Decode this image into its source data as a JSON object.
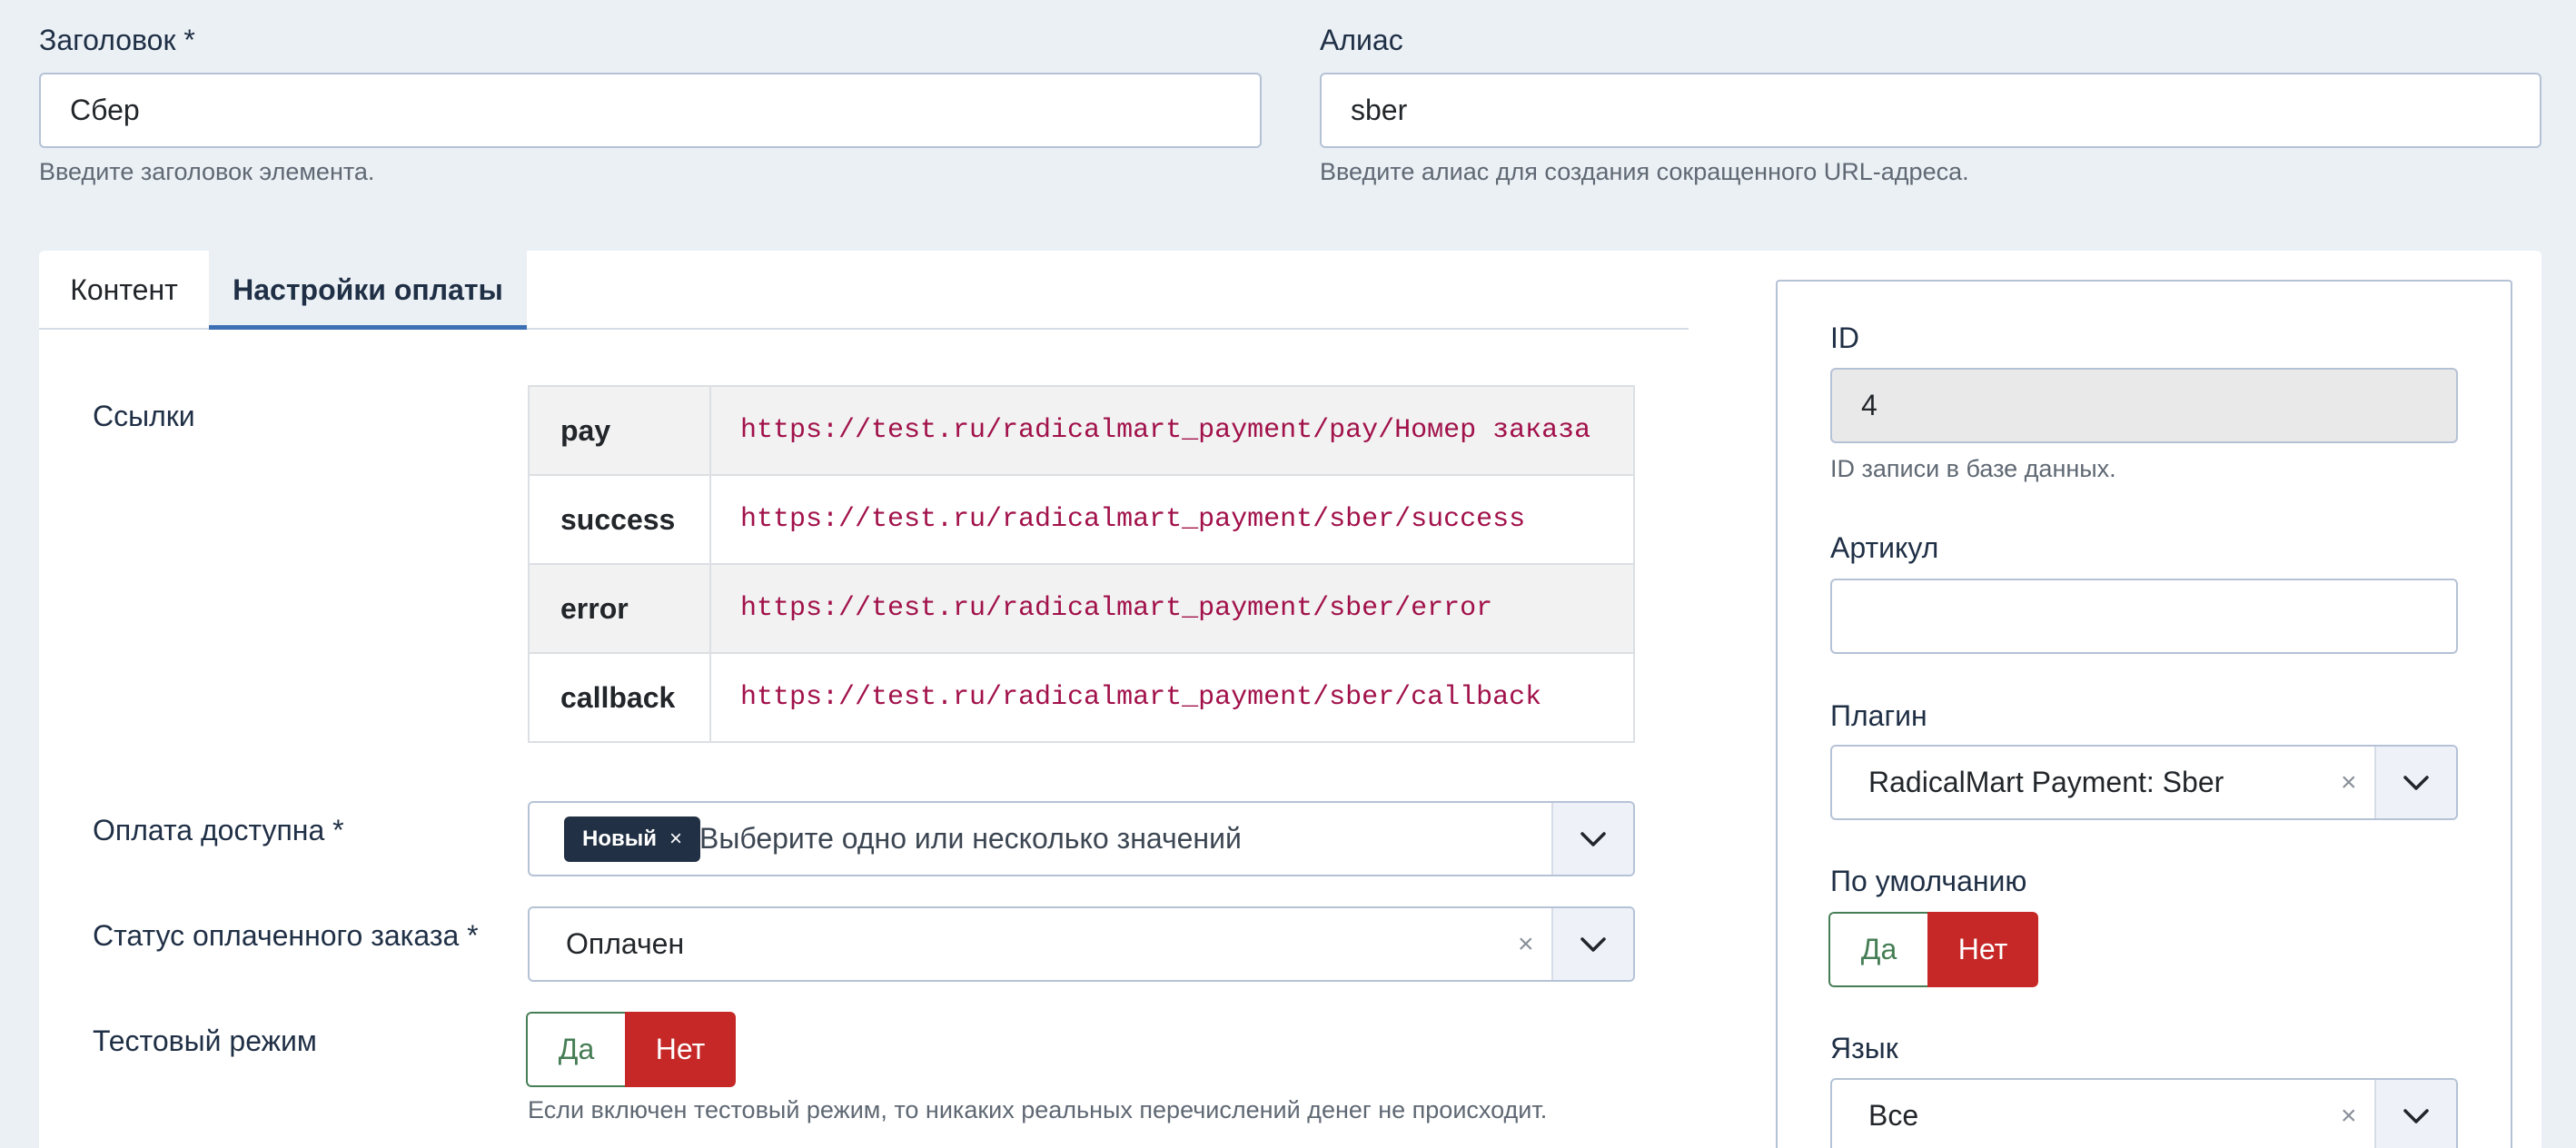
{
  "title_field": {
    "label": "Заголовок *",
    "value": "Сбер",
    "hint": "Введите заголовок элемента."
  },
  "alias_field": {
    "label": "Алиас",
    "value": "sber",
    "hint": "Введите алиас для создания сокращенного URL-адреса."
  },
  "tabs": [
    {
      "label": "Контент",
      "active": false
    },
    {
      "label": "Настройки оплаты",
      "active": true
    }
  ],
  "links": {
    "label": "Ссылки",
    "rows": [
      {
        "key": "pay",
        "url": "https://test.ru/radicalmart_payment/pay/Номер заказа"
      },
      {
        "key": "success",
        "url": "https://test.ru/radicalmart_payment/sber/success"
      },
      {
        "key": "error",
        "url": "https://test.ru/radicalmart_payment/sber/error"
      },
      {
        "key": "callback",
        "url": "https://test.ru/radicalmart_payment/sber/callback"
      }
    ]
  },
  "payment_available": {
    "label": "Оплата доступна *",
    "chip": "Новый",
    "chip_remove": "×",
    "placeholder": "Выберите одно или несколько значений"
  },
  "paid_status": {
    "label": "Статус оплаченного заказа *",
    "value": "Оплачен",
    "clear": "×"
  },
  "test_mode": {
    "label": "Тестовый режим",
    "yes": "Да",
    "no": "Нет",
    "selected": "no",
    "hint": "Если включен тестовый режим, то никаких реальных перечислений денег не происходит."
  },
  "sidebar": {
    "id": {
      "label": "ID",
      "value": "4",
      "hint": "ID записи в базе данных."
    },
    "sku": {
      "label": "Артикул",
      "value": ""
    },
    "plugin": {
      "label": "Плагин",
      "value": "RadicalMart Payment: Sber",
      "clear": "×"
    },
    "default": {
      "label": "По умолчанию",
      "yes": "Да",
      "no": "Нет",
      "selected": "no"
    },
    "language": {
      "label": "Язык",
      "value": "Все",
      "clear": "×"
    }
  },
  "colors": {
    "background": "#ebf0f5",
    "active_tab_underline": "#3d6fb4",
    "chip": "#213044",
    "switch_no": "#c52827",
    "switch_yes_border": "#457d54",
    "url_text": "#a1114a"
  }
}
